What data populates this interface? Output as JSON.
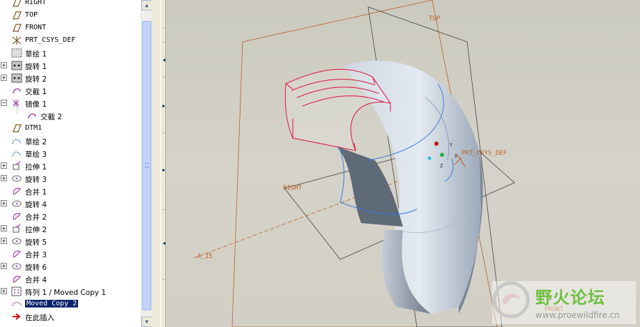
{
  "model_tree": {
    "items": [
      {
        "label": "RIGHT",
        "icon": "datum-plane-icon",
        "indent": 0,
        "expander": "",
        "style": "mono"
      },
      {
        "label": "TOP",
        "icon": "datum-plane-icon",
        "indent": 0,
        "expander": "",
        "style": "mono"
      },
      {
        "label": "FRONT",
        "icon": "datum-plane-icon",
        "indent": 0,
        "expander": "",
        "style": "mono"
      },
      {
        "label": "PRT_CSYS_DEF",
        "icon": "coordinate-system-icon",
        "indent": 0,
        "expander": "",
        "style": "mono"
      },
      {
        "label": "草绘 1",
        "icon": "sketch-icon",
        "indent": 0,
        "expander": "",
        "style": "cjk"
      },
      {
        "label": "旋转 1",
        "icon": "revolve-icon",
        "indent": 0,
        "expander": "+",
        "style": "cjk"
      },
      {
        "label": "旋转 2",
        "icon": "revolve-icon",
        "indent": 0,
        "expander": "+",
        "style": "cjk"
      },
      {
        "label": "交截 1",
        "icon": "intersect-icon",
        "indent": 0,
        "expander": "",
        "style": "cjk"
      },
      {
        "label": "镜像 1",
        "icon": "mirror-icon",
        "indent": 0,
        "expander": "-",
        "style": "cjk"
      },
      {
        "label": "交截 2",
        "icon": "intersect-icon",
        "indent": 1,
        "expander": "",
        "style": "cjk"
      },
      {
        "label": "DTM1",
        "icon": "datum-plane-icon",
        "indent": 0,
        "expander": "",
        "style": "mono"
      },
      {
        "label": "草绘 2",
        "icon": "sketch-curve-icon",
        "indent": 0,
        "expander": "",
        "style": "cjk"
      },
      {
        "label": "草绘 3",
        "icon": "sketch-curve-icon",
        "indent": 0,
        "expander": "",
        "style": "cjk"
      },
      {
        "label": "拉伸 1",
        "icon": "extrude-icon",
        "indent": 0,
        "expander": "+",
        "style": "cjk"
      },
      {
        "label": "旋转 3",
        "icon": "revolve-surface-icon",
        "indent": 0,
        "expander": "+",
        "style": "cjk"
      },
      {
        "label": "合并 1",
        "icon": "merge-icon",
        "indent": 0,
        "expander": "",
        "style": "cjk"
      },
      {
        "label": "旋转 4",
        "icon": "revolve-surface-icon",
        "indent": 0,
        "expander": "+",
        "style": "cjk"
      },
      {
        "label": "合并 2",
        "icon": "merge-icon",
        "indent": 0,
        "expander": "",
        "style": "cjk"
      },
      {
        "label": "拉伸 2",
        "icon": "extrude-icon",
        "indent": 0,
        "expander": "+",
        "style": "cjk"
      },
      {
        "label": "旋转 5",
        "icon": "revolve-surface-icon",
        "indent": 0,
        "expander": "+",
        "style": "cjk"
      },
      {
        "label": "合并 3",
        "icon": "merge-icon",
        "indent": 0,
        "expander": "",
        "style": "cjk"
      },
      {
        "label": "旋转 6",
        "icon": "revolve-surface-icon",
        "indent": 0,
        "expander": "+",
        "style": "cjk"
      },
      {
        "label": "合并 4",
        "icon": "merge-icon",
        "indent": 0,
        "expander": "",
        "style": "cjk"
      },
      {
        "label": "阵列 1 / Moved Copy 1",
        "icon": "pattern-icon",
        "indent": 0,
        "expander": "+",
        "style": "cjk"
      },
      {
        "label": "Moved Copy 2",
        "icon": "moved-copy-icon",
        "indent": 0,
        "expander": "",
        "style": "mono",
        "selected": true
      },
      {
        "label": "在此插入",
        "icon": "insert-here-icon",
        "indent": 0,
        "expander": "",
        "style": "cjk"
      }
    ]
  },
  "viewport": {
    "datum_labels": {
      "top": "TOP",
      "right": "RIGHT",
      "front": "FRONT",
      "csys": "PRT_CSYS_DEF",
      "axis": "A_15"
    },
    "axis_letters": {
      "x": "X",
      "y": "Y",
      "z": "Z"
    },
    "colors": {
      "datum": "#b8602a",
      "highlight": "#e0103a",
      "edge_blue": "#3b78e0",
      "body_light": "#dfe6ee",
      "body_dark": "#5f6b79"
    }
  },
  "watermark": {
    "title": "野火论坛",
    "url": "www.proewildfire.cn"
  }
}
